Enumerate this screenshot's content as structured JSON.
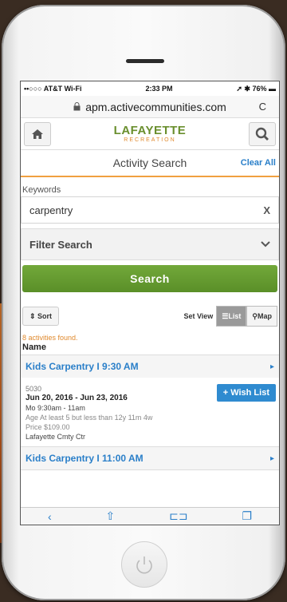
{
  "status": {
    "carrier": "••○○○ AT&T Wi-Fi",
    "time": "2:33 PM",
    "battery": "76%"
  },
  "browser": {
    "url": "apm.activecommunities.com",
    "reload": "C"
  },
  "header": {
    "logo_main": "LAFAYETTE",
    "logo_sub": "RECREATION"
  },
  "title": {
    "text": "Activity Search",
    "clear_all": "Clear All"
  },
  "keywords": {
    "label": "Keywords",
    "value": "carpentry",
    "clear": "X"
  },
  "filter": {
    "label": "Filter Search"
  },
  "search_button": "Search",
  "sort": {
    "label": "⇕ Sort"
  },
  "view": {
    "set_view": "Set View",
    "list": "List",
    "map": "Map"
  },
  "results": {
    "found": "8 activities found.",
    "name_header": "Name",
    "items": [
      {
        "title": "Kids Carpentry I 9:30 AM",
        "code": "5030",
        "dates": "Jun 20, 2016 - Jun 23, 2016",
        "time": "Mo 9:30am - 11am",
        "age": "Age At least 5 but less than 12y 11m 4w",
        "price": "Price $109.00",
        "location": "Lafayette Cmty Ctr",
        "wish": "+ Wish List"
      },
      {
        "title": "Kids Carpentry I 11:00 AM"
      }
    ]
  },
  "colors": {
    "accent_blue": "#2a7fc9",
    "search_green": "#5a8f28",
    "orange": "#e08a2e"
  }
}
